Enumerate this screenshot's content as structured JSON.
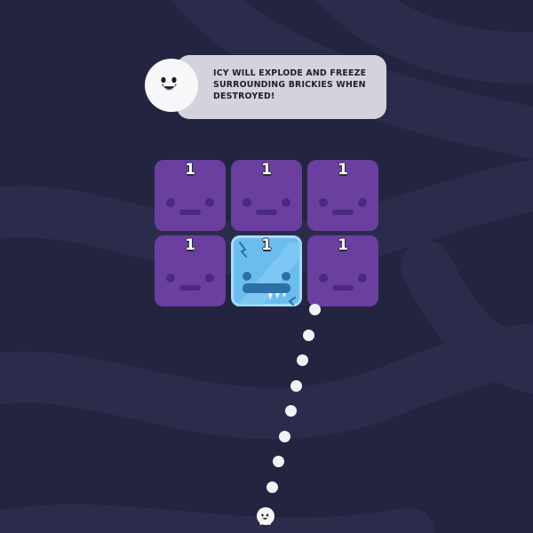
{
  "tutorial": {
    "text": "ICY WILL EXPLODE AND FREEZE\nSURROUNDING BRICKIES WHEN\nDESTROYED!",
    "avatar_icon": "smiling-ball-face-icon"
  },
  "bricks": [
    {
      "row": 0,
      "col": 0,
      "type": "purple",
      "hp": "1"
    },
    {
      "row": 0,
      "col": 1,
      "type": "purple",
      "hp": "1"
    },
    {
      "row": 0,
      "col": 2,
      "type": "purple",
      "hp": "1"
    },
    {
      "row": 1,
      "col": 0,
      "type": "purple",
      "hp": "1"
    },
    {
      "row": 1,
      "col": 1,
      "type": "icy",
      "hp": "1"
    },
    {
      "row": 1,
      "col": 2,
      "type": "purple",
      "hp": "1"
    }
  ],
  "colors": {
    "background": "#232440",
    "background_stripe": "#2c2d4e",
    "purple_brick": "#6a3fa0",
    "purple_face": "#4a2a7e",
    "icy_brick": "#6cbdef",
    "icy_border": "#a6dcfb",
    "bubble": "#d4d2dc",
    "aim_dots": "#f2f2f6"
  },
  "aim": {
    "dot_count": 8,
    "icon": "aim-trajectory-dot"
  },
  "ball": {
    "icon": "ball-with-face-icon"
  }
}
